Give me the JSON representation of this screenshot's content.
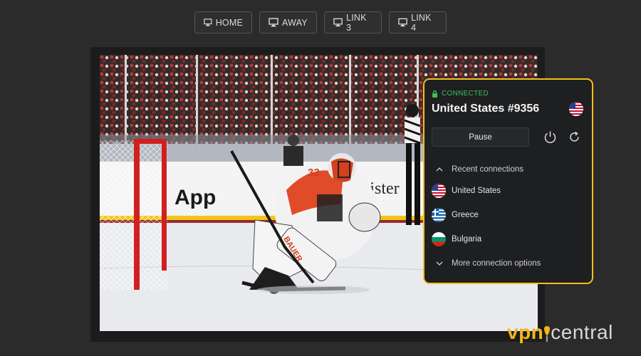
{
  "links": [
    {
      "label": "HOME"
    },
    {
      "label": "AWAY"
    },
    {
      "label": "LINK 3"
    },
    {
      "label": "LINK 4"
    }
  ],
  "video": {
    "board_text_left": "App",
    "board_text_right": "meister",
    "helmet_number": "33",
    "pad_brand": "BAUER"
  },
  "vpn": {
    "status": "CONNECTED",
    "server": "United States #9356",
    "pause_label": "Pause",
    "recent_header": "Recent connections",
    "recent": [
      {
        "country": "United States",
        "flag": "us-flag-icon"
      },
      {
        "country": "Greece",
        "flag": "greece-flag-icon"
      },
      {
        "country": "Bulgaria",
        "flag": "bulgaria-flag-icon"
      }
    ],
    "more_options": "More connection options",
    "colors": {
      "accent": "#f2c01e",
      "connected": "#3fbf5a",
      "panel": "#1e1f21"
    }
  },
  "watermark": {
    "part1": "vpn",
    "part2": "central"
  }
}
